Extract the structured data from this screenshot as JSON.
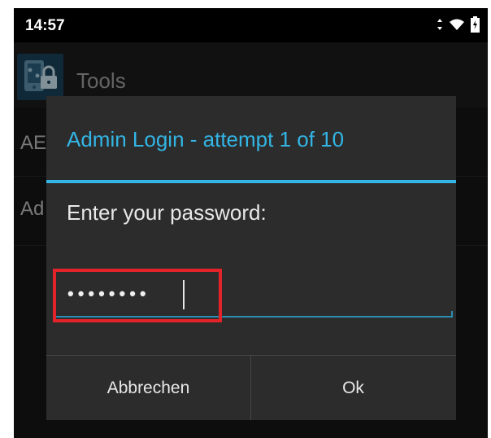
{
  "status_bar": {
    "time": "14:57",
    "icons": [
      "data-transfer-icon",
      "wifi-icon",
      "battery-icon"
    ]
  },
  "action_bar": {
    "title": "Tools",
    "icon": "tools-lock-icon"
  },
  "background_list": [
    {
      "label": "AE"
    },
    {
      "label": "Ad"
    }
  ],
  "dialog": {
    "title": "Admin Login - attempt 1 of 10",
    "message": "Enter your password:",
    "password_value": "••••••••",
    "cancel_label": "Abbrechen",
    "ok_label": "Ok"
  },
  "colors": {
    "accent": "#33b5e5",
    "highlight": "#e2232a",
    "dialog_bg": "#2c2c2c"
  }
}
